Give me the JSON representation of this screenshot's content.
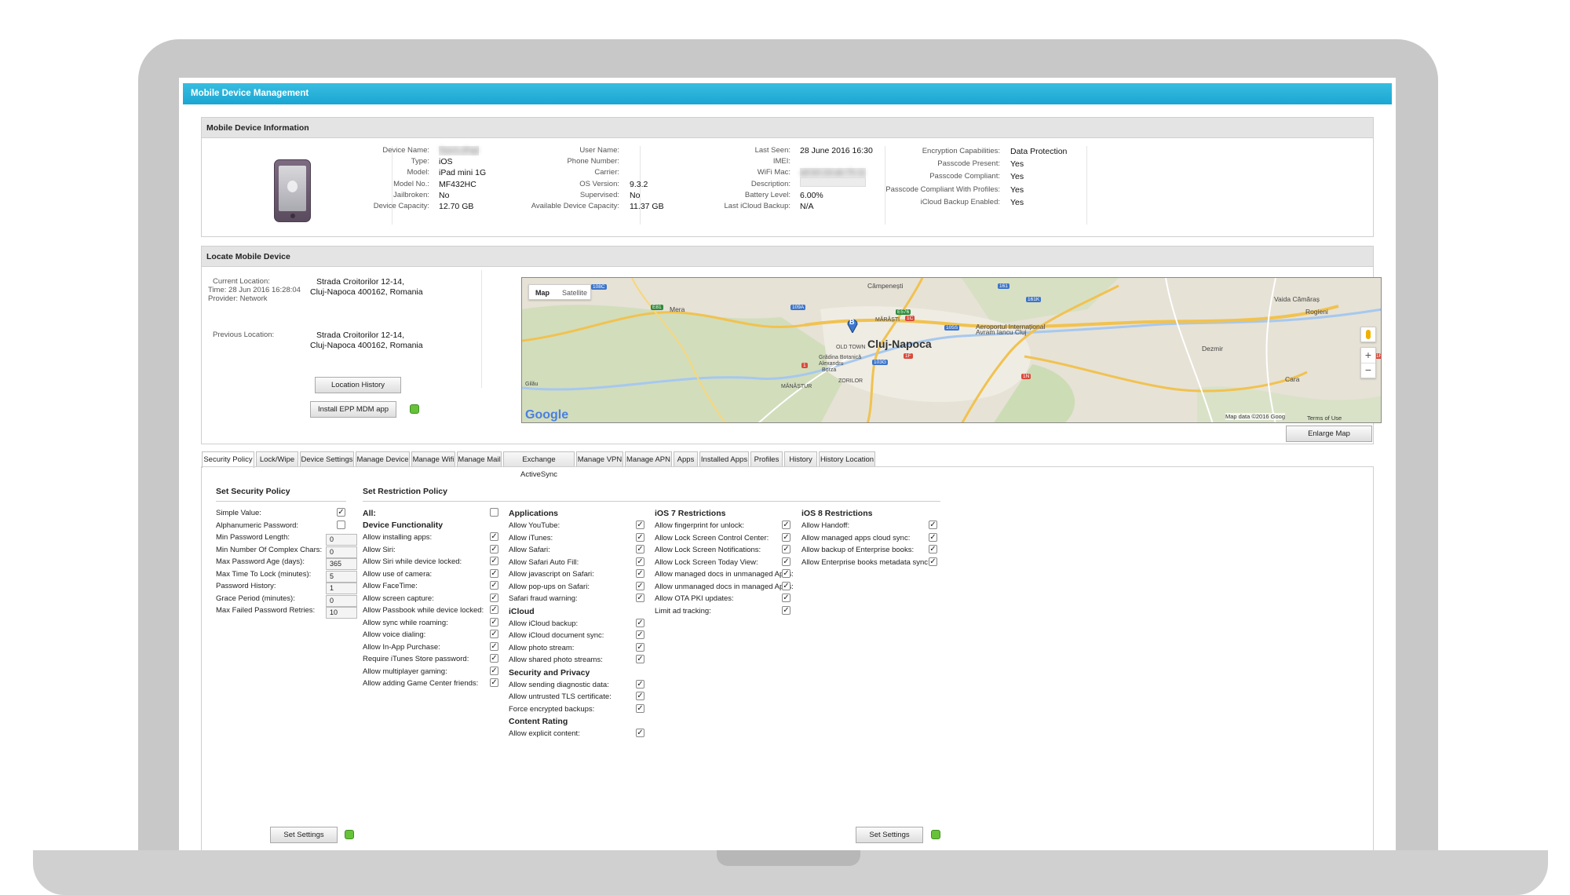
{
  "app_title": "Mobile Device Management",
  "device_info": {
    "title": "Mobile Device Information",
    "col1": [
      {
        "label": "Device Name:",
        "value": "Tom's iPad",
        "blurred": true
      },
      {
        "label": "Type:",
        "value": "iOS"
      },
      {
        "label": "Model:",
        "value": "iPad mini 1G"
      },
      {
        "label": "Model No.:",
        "value": "MF432HC"
      },
      {
        "label": "Jailbroken:",
        "value": "No"
      },
      {
        "label": "Device Capacity:",
        "value": "12.70 GB"
      }
    ],
    "col2": [
      {
        "label": "User Name:",
        "value": ""
      },
      {
        "label": "Phone Number:",
        "value": ""
      },
      {
        "label": "Carrier:",
        "value": ""
      },
      {
        "label": "OS Version:",
        "value": "9.3.2"
      },
      {
        "label": "Supervised:",
        "value": "No"
      },
      {
        "label": "Available Device Capacity:",
        "value": "11.37 GB"
      }
    ],
    "col3": [
      {
        "label": "Last Seen:",
        "value": "28 June 2016 16:30"
      },
      {
        "label": "IMEI:",
        "value": ""
      },
      {
        "label": "WiFi Mac:",
        "value": "a8:b0:2d:ab:75:11",
        "blurred": true
      },
      {
        "label": "Description:",
        "value": ""
      },
      {
        "label": "Battery Level:",
        "value": "6.00%"
      },
      {
        "label": "Last iCloud Backup:",
        "value": "N/A"
      }
    ],
    "col4": [
      {
        "label": "Encryption Capabilities:",
        "value": "Data Protection"
      },
      {
        "label": "Passcode Present:",
        "value": "Yes"
      },
      {
        "label": "Passcode Compliant:",
        "value": "Yes"
      },
      {
        "label": "Passcode Compliant With Profiles:",
        "value": "Yes"
      },
      {
        "label": "iCloud Backup Enabled:",
        "value": "Yes"
      }
    ]
  },
  "locate": {
    "title": "Locate Mobile Device",
    "current_label": "Current Location:",
    "current_time": "Time: 28 Jun 2016 16:28:04",
    "current_provider": "Provider: Network",
    "current_address_1": "Strada Croitorilor 12-14,",
    "current_address_2": "Cluj-Napoca 400162, Romania",
    "previous_label": "Previous Location:",
    "previous_address_1": "Strada Croitorilor 12-14,",
    "previous_address_2": "Cluj-Napoca 400162, Romania",
    "location_history_button": "Location History",
    "install_button": "Install EPP MDM app",
    "enlarge_button": "Enlarge Map",
    "map": {
      "tab_map": "Map",
      "tab_satellite": "Satellite",
      "city": "Cluj-Napoca",
      "places": [
        "Câmpenești",
        "Vaida Cămăraș",
        "Mera",
        "Rogieni",
        "Aeroportul Internațional",
        "Avram Iancu Cluj",
        "Dezmir",
        "OLD TOWN",
        "Grădina Botanică",
        "Alexandru",
        "Borza",
        "ZORILOR",
        "MĂRĂȘTI",
        "MĂNĂȘTUR",
        "Gilău",
        "Cara"
      ],
      "roads": [
        "108C",
        "E81",
        "109A",
        "E576",
        "1C",
        "105S",
        "161",
        "161K",
        "103G",
        "1",
        "1F",
        "1N",
        "1R"
      ],
      "marker": "B",
      "google": "Google",
      "copyright": "Map data ©2016 Goog",
      "terms": "Terms of Use",
      "zoom_in": "+",
      "zoom_out": "−"
    }
  },
  "tabs": [
    "Security Policy",
    "Lock/Wipe",
    "Device Settings",
    "Manage Device",
    "Manage Wifi",
    "Manage Mail",
    "Exchange ActiveSync",
    "Manage VPN",
    "Manage APN",
    "Apps",
    "Installed Apps",
    "Profiles",
    "History",
    "History Location"
  ],
  "security_policy": {
    "title": "Set Security Policy",
    "simple_value": {
      "label": "Simple Value:",
      "checked": true
    },
    "alphanumeric": {
      "label": "Alphanumeric Password:",
      "checked": false
    },
    "fields": [
      {
        "label": "Min Password Length:",
        "value": "0"
      },
      {
        "label": "Min Number Of Complex Chars:",
        "value": "0"
      },
      {
        "label": "Max Password Age (days):",
        "value": "365"
      },
      {
        "label": "Max Time To Lock (minutes):",
        "value": "5"
      },
      {
        "label": "Password History:",
        "value": "1"
      },
      {
        "label": "Grace Period (minutes):",
        "value": "0"
      },
      {
        "label": "Max Failed Password Retries:",
        "value": "10"
      }
    ],
    "button": "Set Settings"
  },
  "restriction": {
    "title": "Set Restriction Policy",
    "all_label": "All:",
    "device_functionality": "Device Functionality",
    "col1": [
      "Allow installing apps:",
      "Allow Siri:",
      "Allow Siri while device locked:",
      "Allow use of camera:",
      "Allow FaceTime:",
      "Allow screen capture:",
      "Allow Passbook while device locked:",
      "Allow sync while roaming:",
      "Allow voice dialing:",
      "Allow In-App Purchase:",
      "Require iTunes Store password:",
      "Allow multiplayer gaming:",
      "Allow adding Game Center friends:"
    ],
    "applications": "Applications",
    "col2a": [
      "Allow YouTube:",
      "Allow iTunes:",
      "Allow Safari:",
      "Allow Safari Auto Fill:",
      "Allow javascript on Safari:",
      "Allow pop-ups on Safari:",
      "Safari fraud warning:"
    ],
    "icloud": "iCloud",
    "col2b": [
      "Allow iCloud backup:",
      "Allow iCloud document sync:",
      "Allow photo stream:",
      "Allow shared photo streams:"
    ],
    "security_privacy": "Security and Privacy",
    "col2c": [
      "Allow sending diagnostic data:",
      "Allow untrusted TLS certificate:",
      "Force encrypted backups:"
    ],
    "content_rating": "Content Rating",
    "col2d": [
      "Allow explicit content:"
    ],
    "ios7": "iOS 7 Restrictions",
    "col3": [
      "Allow fingerprint for unlock:",
      "Allow Lock Screen Control Center:",
      "Allow Lock Screen Notifications:",
      "Allow Lock Screen Today View:",
      "Allow managed docs in unmanaged Apps:",
      "Allow unmanaged docs in managed Apps:",
      "Allow OTA PKI updates:",
      "Limit ad tracking:"
    ],
    "ios8": "iOS 8 Restrictions",
    "col4": [
      "Allow Handoff:",
      "Allow managed apps cloud sync:",
      "Allow backup of Enterprise books:",
      "Allow Enterprise books metadata sync:"
    ],
    "button": "Set Settings"
  },
  "check_mark": "✓",
  "colors": {
    "accent": "#1aa6d3",
    "led": "#67c23a"
  }
}
